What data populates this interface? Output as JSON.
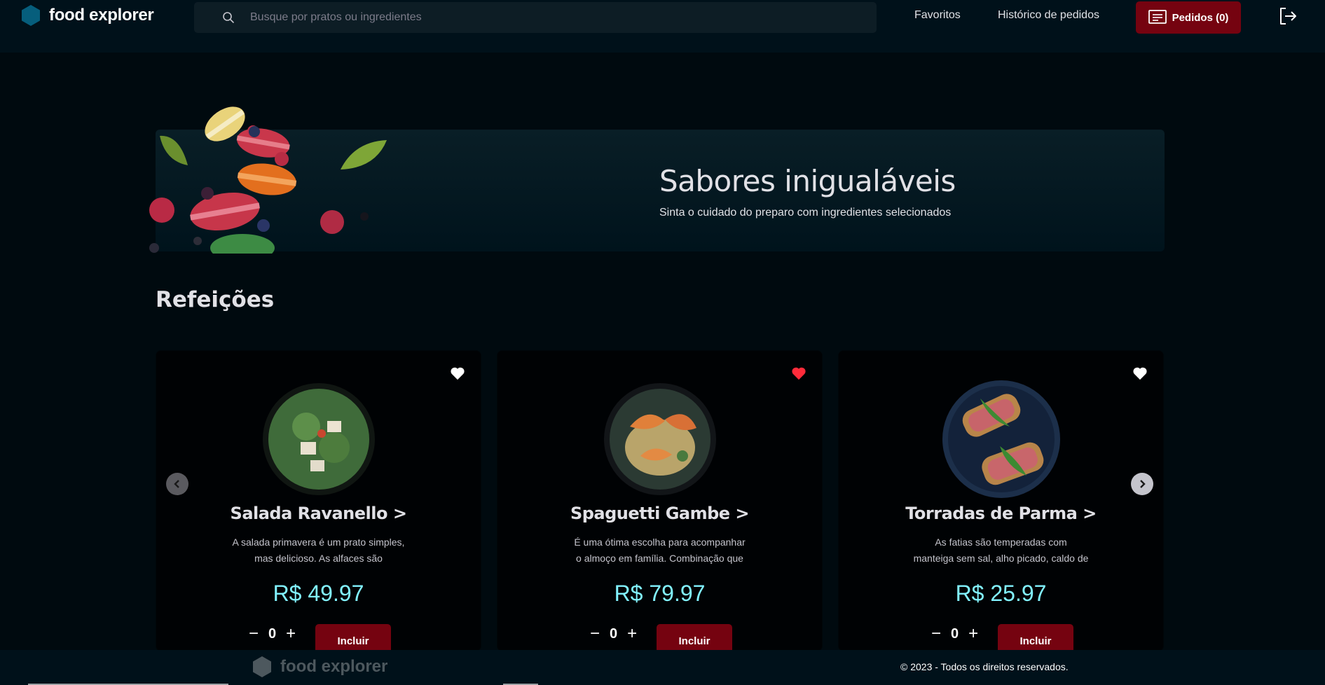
{
  "header": {
    "logo_text": "food explorer",
    "search_placeholder": "Busque por pratos ou ingredientes",
    "nav_favorites": "Favoritos",
    "nav_history": "Histórico de pedidos",
    "orders_label": "Pedidos (0)"
  },
  "banner": {
    "title": "Sabores inigualáveis",
    "subtitle": "Sinta o cuidado do preparo com ingredientes selecionados"
  },
  "section": {
    "title": "Refeições"
  },
  "dishes": [
    {
      "name": "Salada Ravanello >",
      "desc1": "A salada primavera é um prato simples,",
      "desc2": "mas delicioso. As alfaces são",
      "price": "R$ 49.97",
      "quantity": "0",
      "include": "Incluir",
      "favorited": false
    },
    {
      "name": "Spaguetti Gambe >",
      "desc1": "É uma ótima escolha para acompanhar",
      "desc2": "o almoço em família. Combinação que",
      "price": "R$ 79.97",
      "quantity": "0",
      "include": "Incluir",
      "favorited": true
    },
    {
      "name": "Torradas de Parma >",
      "desc1": "As fatias são temperadas com",
      "desc2": "manteiga sem sal, alho picado, caldo de",
      "price": "R$ 25.97",
      "quantity": "0",
      "include": "Incluir",
      "favorited": false
    }
  ],
  "footer": {
    "logo_text": "food explorer",
    "copyright": "© 2023 - Todos os direitos reservados."
  },
  "colors": {
    "accent": "#750310",
    "price": "#82f3ff",
    "logo": "#065e7c",
    "favorite_active": "#ff2b3a"
  }
}
